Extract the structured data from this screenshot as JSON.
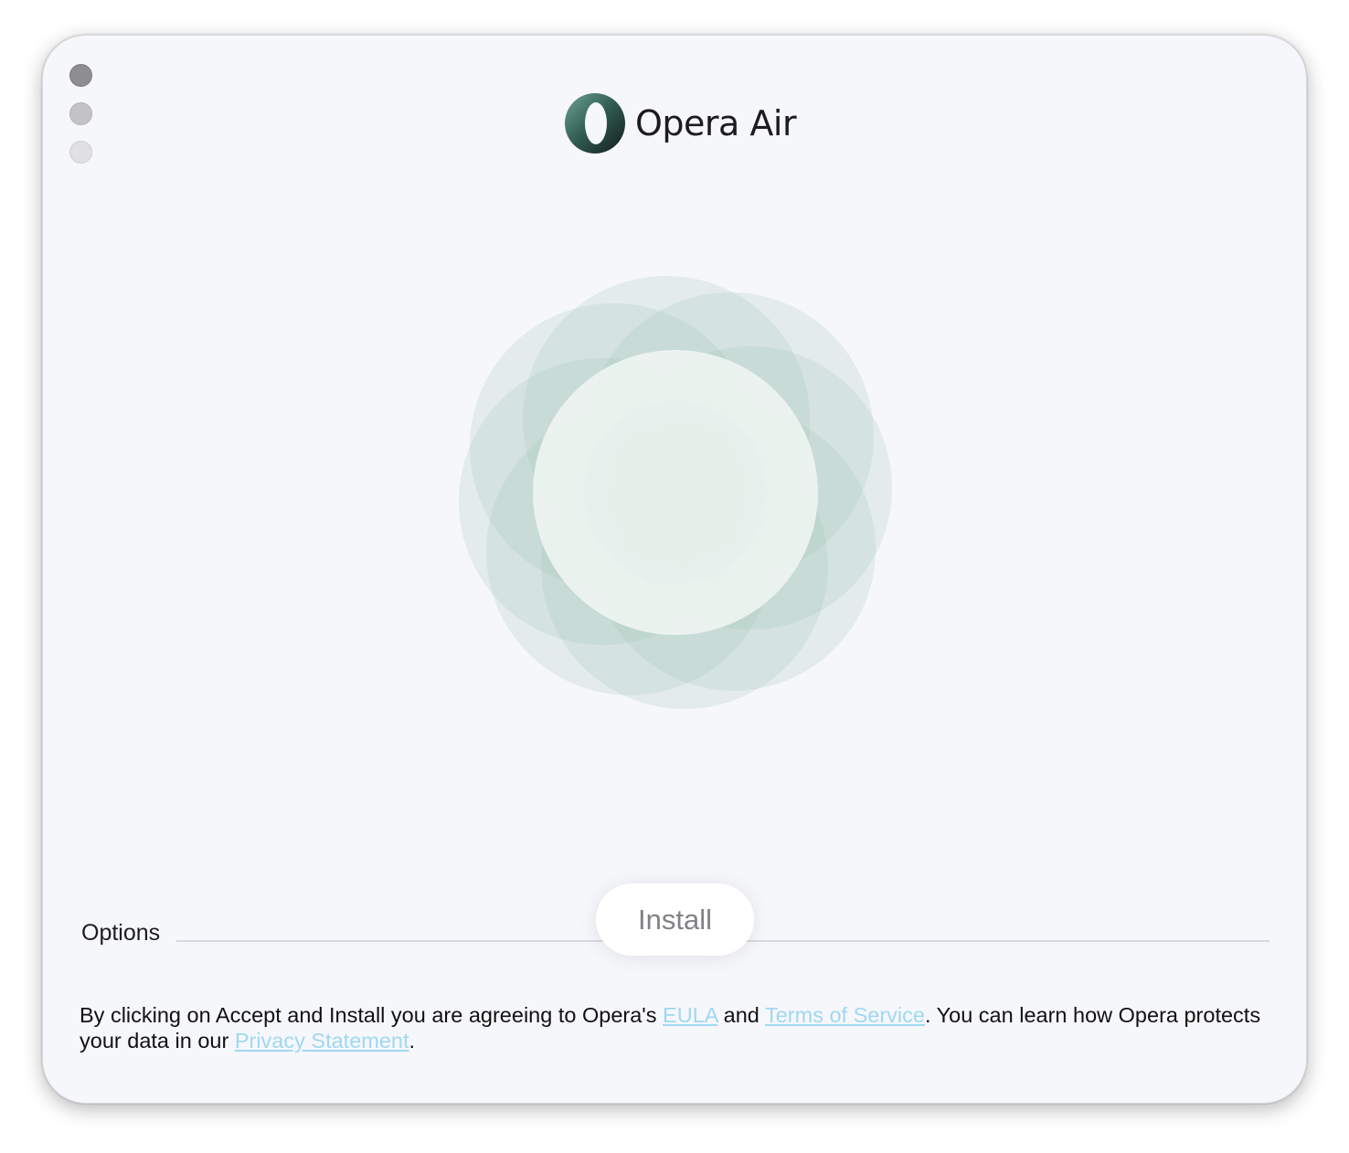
{
  "app": {
    "brand_name": "Opera Air"
  },
  "colors": {
    "window_bg": "#f6f7fb",
    "accent_green": "#8fb7a8",
    "link": "#9fd8f2"
  },
  "install": {
    "button_label": "Install"
  },
  "options": {
    "label": "Options"
  },
  "legal": {
    "text_1": "By clicking on Accept and Install you are agreeing to Opera's ",
    "eula_link": "EULA",
    "text_2": " and ",
    "tos_link": "Terms of Service",
    "text_3": ". You can learn how Opera protects your data in our ",
    "privacy_link": "Privacy Statement",
    "text_4": "."
  }
}
